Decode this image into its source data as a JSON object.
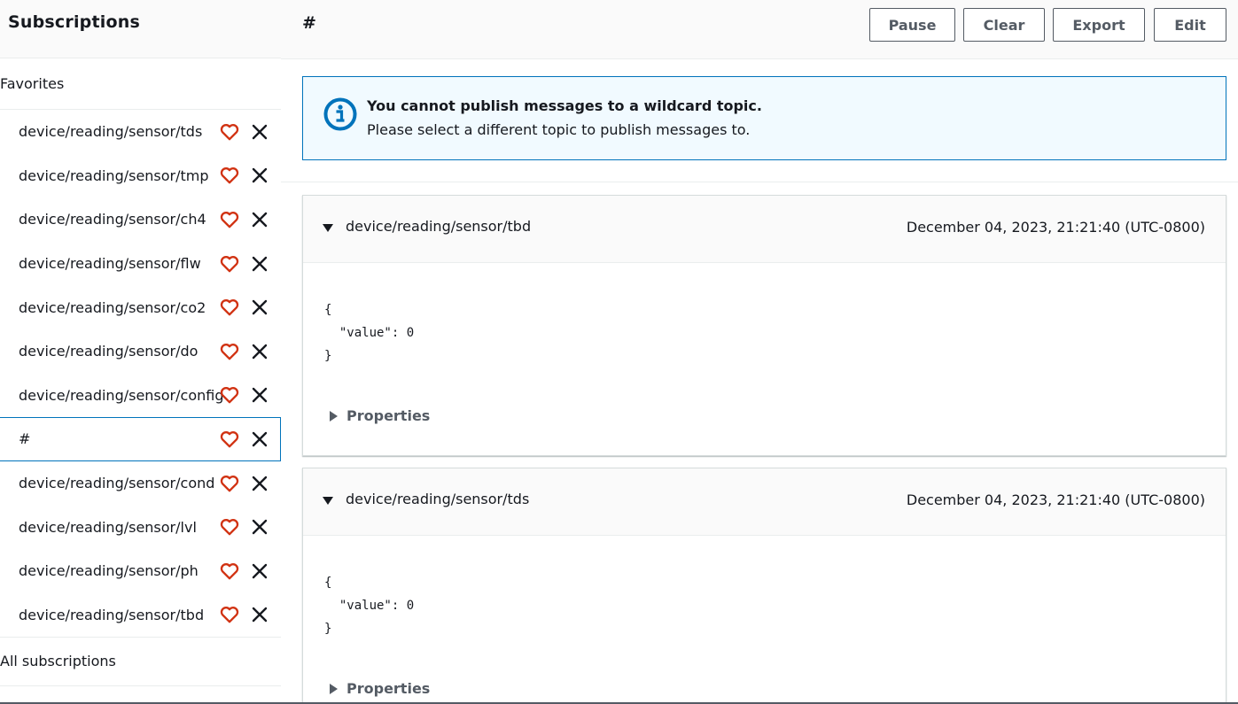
{
  "sidebar": {
    "title": "Subscriptions",
    "favorites_label": "Favorites",
    "favorites": [
      {
        "label": "device/reading/sensor/tds"
      },
      {
        "label": "device/reading/sensor/tmp"
      },
      {
        "label": "device/reading/sensor/ch4"
      },
      {
        "label": "device/reading/sensor/flw"
      },
      {
        "label": "device/reading/sensor/co2"
      },
      {
        "label": "device/reading/sensor/do"
      },
      {
        "label": "device/reading/sensor/config"
      },
      {
        "label": "#",
        "selected": true
      },
      {
        "label": "device/reading/sensor/cond"
      },
      {
        "label": "device/reading/sensor/lvl"
      },
      {
        "label": "device/reading/sensor/ph"
      },
      {
        "label": "device/reading/sensor/tbd"
      }
    ],
    "all_label": "All subscriptions"
  },
  "header": {
    "topic": "#",
    "buttons": {
      "pause": "Pause",
      "clear": "Clear",
      "export": "Export",
      "edit": "Edit"
    }
  },
  "alert": {
    "icon": "info-icon",
    "title": "You cannot publish messages to a wildcard topic.",
    "body": "Please select a different topic to publish messages to."
  },
  "messages": [
    {
      "topic": "device/reading/sensor/tbd",
      "timestamp": "December 04, 2023, 21:21:40 (UTC-0800)",
      "payload": "{\n  \"value\": 0\n}",
      "properties_label": "Properties"
    },
    {
      "topic": "device/reading/sensor/tds",
      "timestamp": "December 04, 2023, 21:21:40 (UTC-0800)",
      "payload": "{\n  \"value\": 0\n}",
      "properties_label": "Properties"
    }
  ],
  "colors": {
    "accent": "#0073bb",
    "heart": "#d13212",
    "alert_bg": "#f1faff"
  }
}
